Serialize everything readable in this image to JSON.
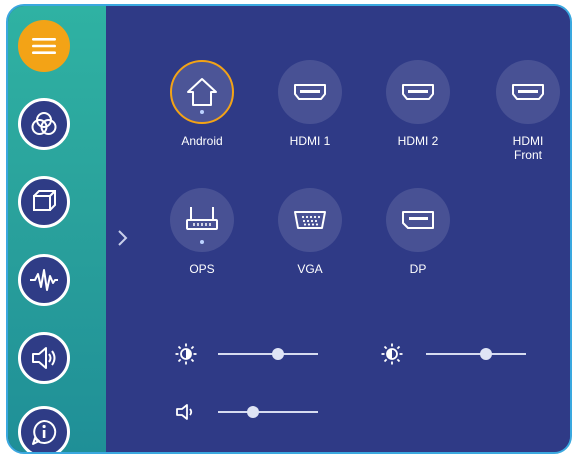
{
  "sidebar": {
    "items": [
      {
        "icon": "menu-icon"
      },
      {
        "icon": "color-circles-icon"
      },
      {
        "icon": "display-cube-icon"
      },
      {
        "icon": "waveform-icon"
      },
      {
        "icon": "speaker-icon"
      },
      {
        "icon": "info-icon"
      }
    ],
    "accent_color": "#f3a316"
  },
  "sources": [
    {
      "label": "Android",
      "icon": "home-icon",
      "active": true
    },
    {
      "label": "HDMI 1",
      "icon": "hdmi-icon"
    },
    {
      "label": "HDMI 2",
      "icon": "hdmi-icon"
    },
    {
      "label": "HDMI\nFront",
      "icon": "hdmi-icon"
    },
    {
      "label": "OPS",
      "icon": "router-icon"
    },
    {
      "label": "VGA",
      "icon": "vga-icon"
    },
    {
      "label": "DP",
      "icon": "displayport-icon"
    }
  ],
  "sliders": {
    "brightness": {
      "icon": "sun-icon",
      "level": 0.6
    },
    "contrast": {
      "icon": "contrast-sun-icon",
      "level": 0.6
    },
    "volume": {
      "icon": "speaker-icon",
      "level": 0.35
    }
  }
}
